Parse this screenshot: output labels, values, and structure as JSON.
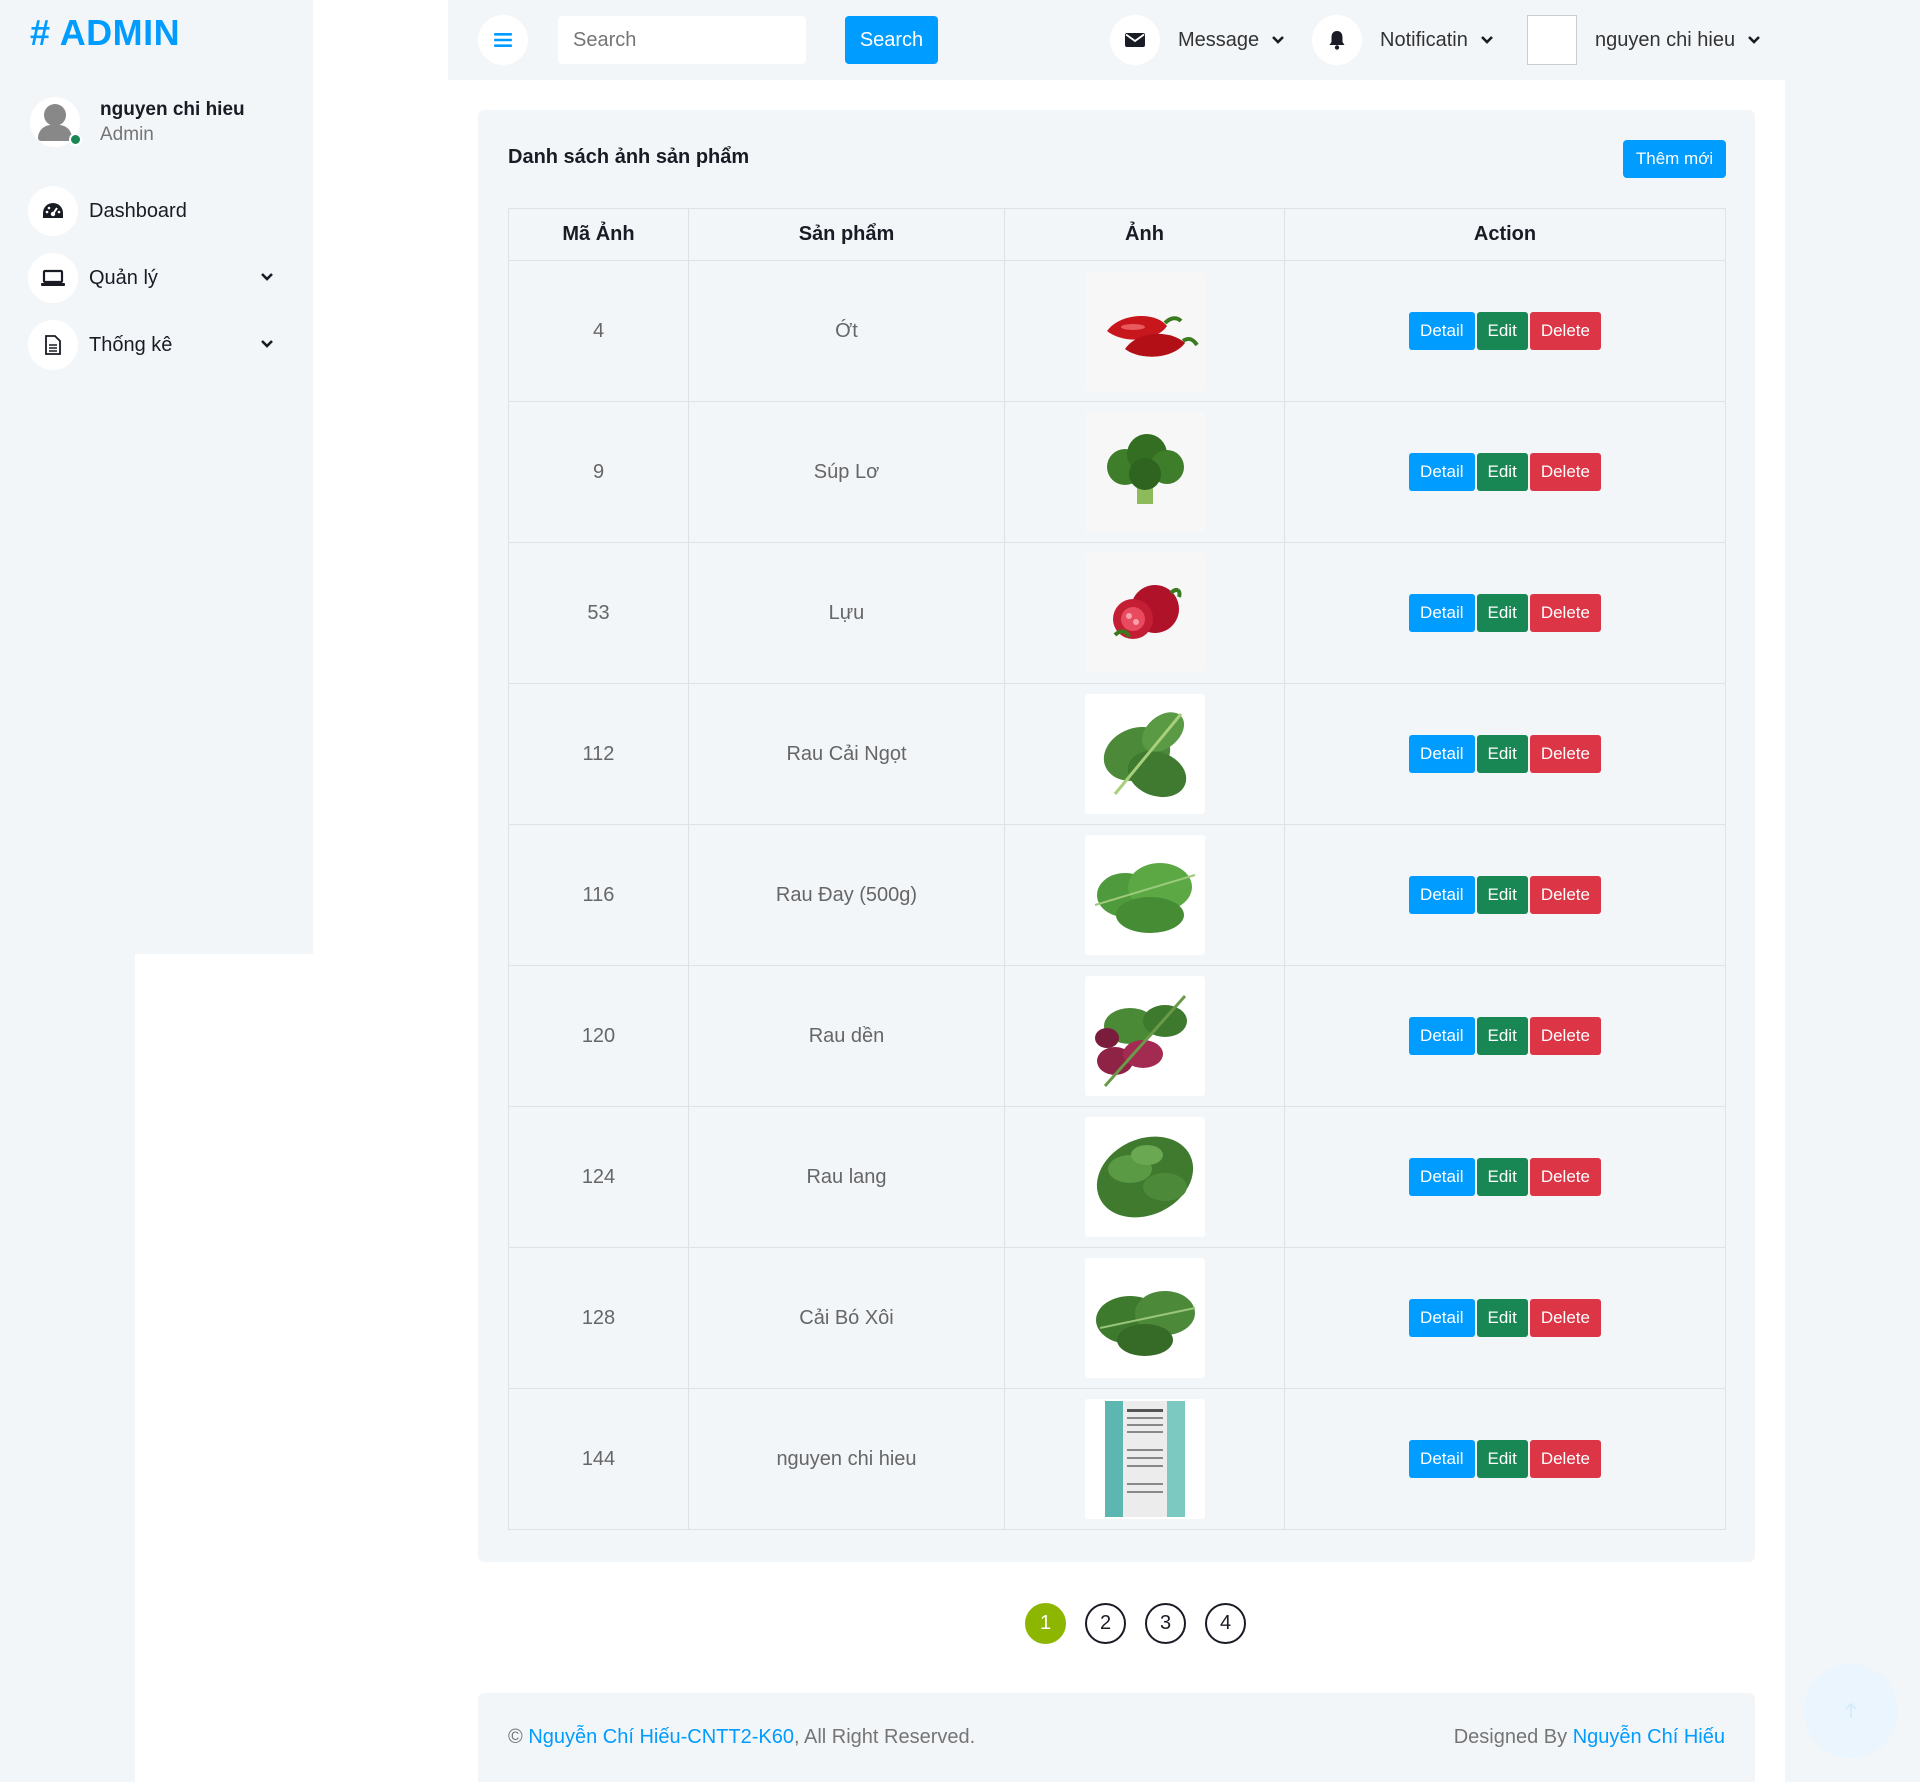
{
  "brand": {
    "title": "# ADMIN"
  },
  "user": {
    "name": "nguyen chi hieu",
    "role": "Admin"
  },
  "sidebar": {
    "items": [
      {
        "label": "Dashboard",
        "icon": "tachometer-icon"
      },
      {
        "label": "Quản lý",
        "icon": "laptop-icon"
      },
      {
        "label": "Thống kê",
        "icon": "file-icon"
      }
    ]
  },
  "topbar": {
    "search_placeholder": "Search",
    "search_label": "Search",
    "message_label": "Message",
    "notification_label": "Notificatin",
    "profile_label": "nguyen chi hieu"
  },
  "card": {
    "title": "Danh sách ảnh sản phẩm",
    "add_label": "Thêm mới"
  },
  "table": {
    "headers": [
      "Mã Ảnh",
      "Sản phẩm",
      "Ảnh",
      "Action"
    ],
    "rows": [
      {
        "id": "4",
        "product": "Ớt"
      },
      {
        "id": "9",
        "product": "Súp Lơ"
      },
      {
        "id": "53",
        "product": "Lựu"
      },
      {
        "id": "112",
        "product": "Rau Cải Ngọt"
      },
      {
        "id": "116",
        "product": "Rau Đay (500g)"
      },
      {
        "id": "120",
        "product": "Rau dền"
      },
      {
        "id": "124",
        "product": "Rau lang"
      },
      {
        "id": "128",
        "product": "Cải Bó Xôi"
      },
      {
        "id": "144",
        "product": "nguyen chi hieu"
      }
    ],
    "actions": {
      "detail": "Detail",
      "edit": "Edit",
      "delete": "Delete"
    }
  },
  "pagination": {
    "pages": [
      "1",
      "2",
      "3",
      "4"
    ],
    "current": "1"
  },
  "footer": {
    "copyright_symbol": "©",
    "owner_link": "Nguyễn Chí Hiếu-CNTT2-K60",
    "rights": ", All Right Reserved.",
    "designed_by": "Designed By",
    "designer_link": "Nguyễn Chí Hiếu"
  },
  "colors": {
    "primary": "#009CFF",
    "success": "#198754",
    "danger": "#DC3545",
    "active_page": "#8DB600",
    "background": "#F3F6F9"
  }
}
